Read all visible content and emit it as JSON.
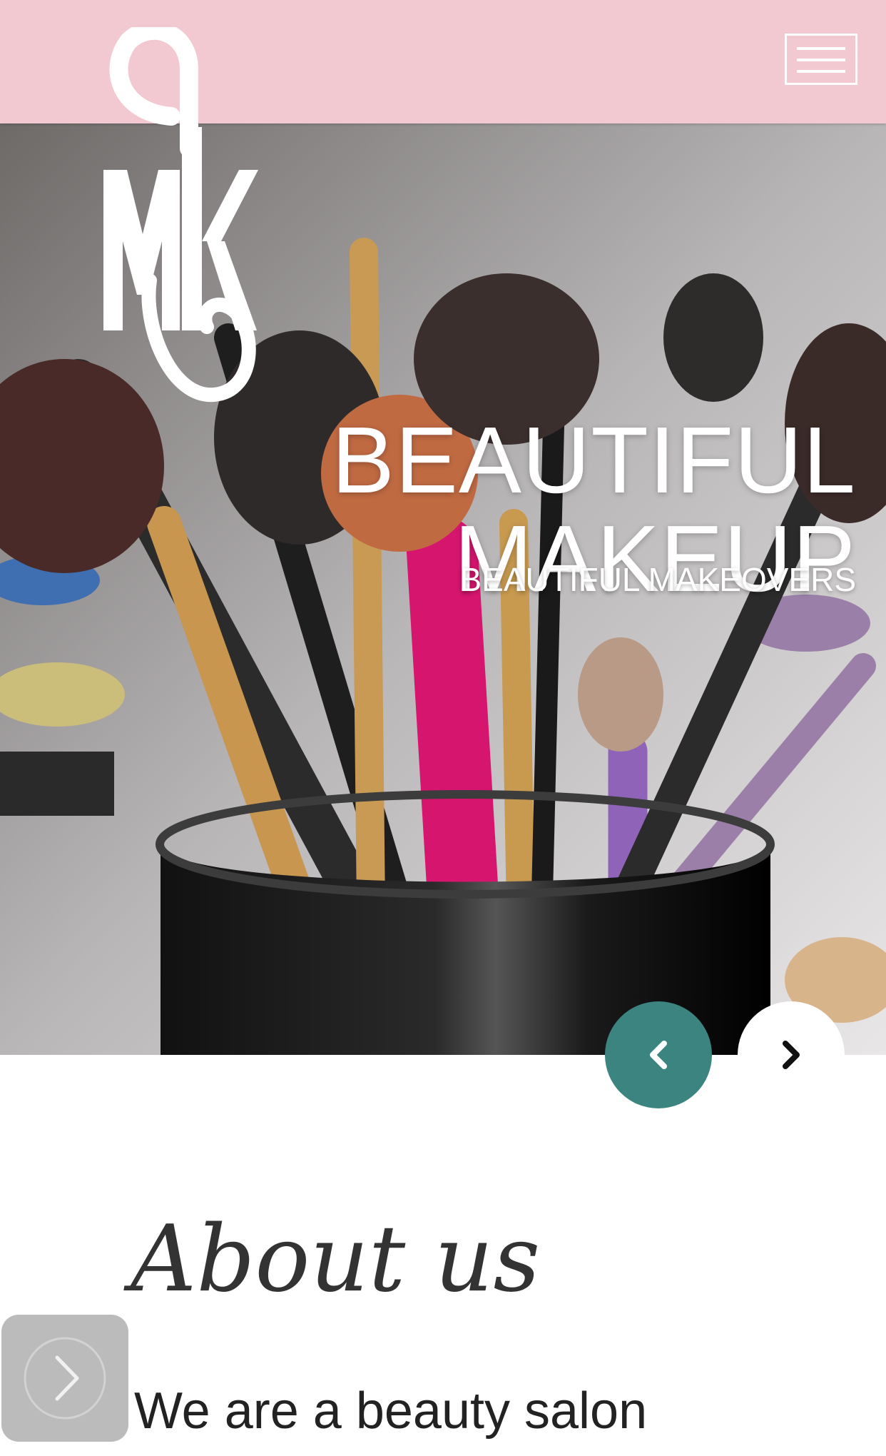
{
  "header": {
    "background": "#f3c9d1",
    "logo_text": "MK",
    "menu_icon": "hamburger-icon"
  },
  "hero": {
    "title_line1": "BEAUTIFUL",
    "title_line2": "MAKEUP",
    "subtitle": "BEAUTIFUL MAKEOVERS",
    "prev_icon": "chevron-left-icon",
    "next_icon": "chevron-right-icon",
    "accent": "#3b8480"
  },
  "about": {
    "heading": "About us",
    "text": "We are a beauty salon"
  },
  "floating_button": {
    "icon": "chevron-right-icon"
  }
}
